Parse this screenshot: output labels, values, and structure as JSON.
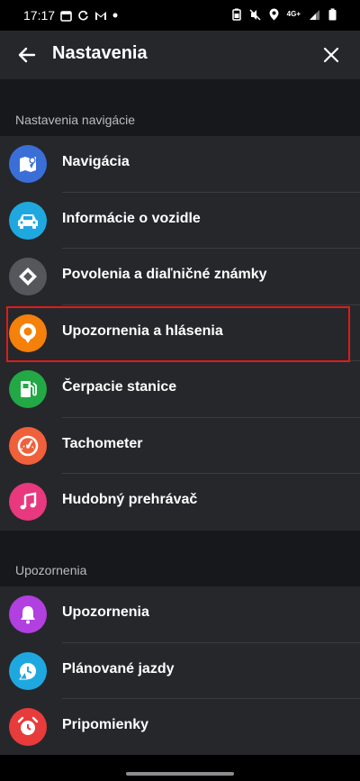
{
  "status_bar": {
    "time": "17:17",
    "network": "4G+"
  },
  "header": {
    "title": "Nastavenia"
  },
  "sections": [
    {
      "title": "Nastavenia navigácie",
      "items": [
        {
          "label": "Navigácia",
          "icon": "navigation-map-icon",
          "color": "#3a6fd8"
        },
        {
          "label": "Informácie o vozidle",
          "icon": "car-icon",
          "color": "#1fa8e0"
        },
        {
          "label": "Povolenia a diaľničné známky",
          "icon": "road-sign-diamond-icon",
          "color": "#55575c"
        },
        {
          "label": "Upozornenia a hlásenia",
          "icon": "location-alert-icon",
          "color": "#f5800a"
        },
        {
          "label": "Čerpacie stanice",
          "icon": "fuel-pump-icon",
          "color": "#22a845"
        },
        {
          "label": "Tachometer",
          "icon": "speedometer-icon",
          "color": "#f0603a"
        },
        {
          "label": "Hudobný prehrávač",
          "icon": "music-note-icon",
          "color": "#e8387e"
        }
      ]
    },
    {
      "title": "Upozornenia",
      "items": [
        {
          "label": "Upozornenia",
          "icon": "bell-icon",
          "color": "#b23fe0"
        },
        {
          "label": "Plánované jazdy",
          "icon": "planned-drive-icon",
          "color": "#1fa8e0"
        },
        {
          "label": "Pripomienky",
          "icon": "alarm-clock-icon",
          "color": "#e83b3b"
        }
      ]
    }
  ],
  "highlight_color": "#e01b1b"
}
